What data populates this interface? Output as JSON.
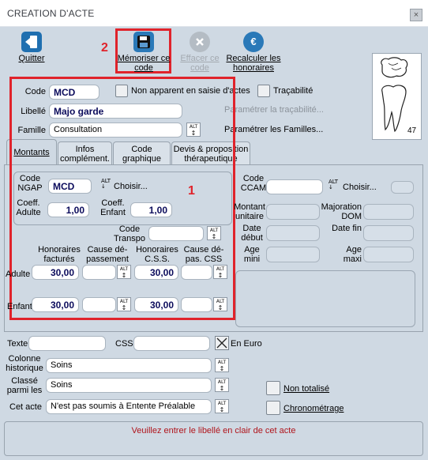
{
  "window": {
    "title": "CREATION D'ACTE",
    "close_glyph": "×"
  },
  "toolbar": [
    {
      "label": "Quitter",
      "icon": "exit-icon",
      "disabled": false
    },
    {
      "label": "Mémoriser ce code",
      "icon": "save-icon",
      "disabled": false
    },
    {
      "label": "Effacer ce code",
      "icon": "delete-icon",
      "disabled": true
    },
    {
      "label": "Recalculer les honoraires",
      "icon": "euro-refresh-icon",
      "disabled": false
    }
  ],
  "annotations": {
    "num1": "1",
    "num2": "2",
    "color": "#e0232b"
  },
  "tooth_count": "47",
  "header": {
    "code_label": "Code",
    "code_value": "MCD",
    "non_apparent_label": "Non apparent en saisie d'actes",
    "tracabilite_label": "Traçabilité",
    "libelle_label": "Libellé",
    "libelle_value": "Majo garde",
    "parametrer_tracabilite": "Paramétrer la traçabilité...",
    "famille_label": "Famille",
    "famille_value": "Consultation",
    "parametrer_familles": "Paramétrer les Familles..."
  },
  "tabs": [
    {
      "label": "Montants",
      "active": true
    },
    {
      "label": "Infos complément.",
      "active": false
    },
    {
      "label": "Code graphique",
      "active": false
    },
    {
      "label": "Devis & proposition thérapeutique",
      "active": false
    }
  ],
  "ngap": {
    "code_label": "Code NGAP",
    "code_value": "MCD",
    "choisir": "Choisir...",
    "coeff_adulte_label": "Coeff. Adulte",
    "coeff_adulte_value": "1,00",
    "coeff_enfant_label": "Coeff. Enfant",
    "coeff_enfant_value": "1,00",
    "code_transpo_label": "Code Transpo",
    "col_honoraires_factures": "Honoraires facturés",
    "col_cause_depassement": "Cause dé- passement",
    "col_honoraires_css": "Honoraires C.S.S.",
    "col_cause_depas_css": "Cause dé- pas. CSS",
    "row_adulte": "Adulte",
    "adulte_hono": "30,00",
    "adulte_css": "30,00",
    "row_enfant": "Enfant",
    "enfant_hono": "30,00",
    "enfant_css": "30,00"
  },
  "ccam": {
    "code_label": "Code CCAM",
    "choisir": "Choisir...",
    "montant_unitaire": "Montant unitaire",
    "majoration_dom": "Majoration DOM",
    "date_debut": "Date début",
    "date_fin": "Date fin",
    "age_mini": "Age mini",
    "age_maxi": "Age maxi"
  },
  "bottom": {
    "texte_label": "Texte",
    "css_label": "CSS",
    "en_euro_label": "En Euro",
    "colonne_historique_label": "Colonne historique",
    "colonne_historique_value": "Soins",
    "classe_parmi_label": "Classé parmi les",
    "classe_parmi_value": "Soins",
    "cet_acte_label": "Cet acte",
    "cet_acte_value": "N'est pas soumis à Entente Préalable",
    "non_totalise_label": "Non totalisé",
    "chronometrage_label": "Chronométrage"
  },
  "status_message": "Veuillez entrer le libellé en clair de cet acte",
  "alt_glyph": "ALT"
}
